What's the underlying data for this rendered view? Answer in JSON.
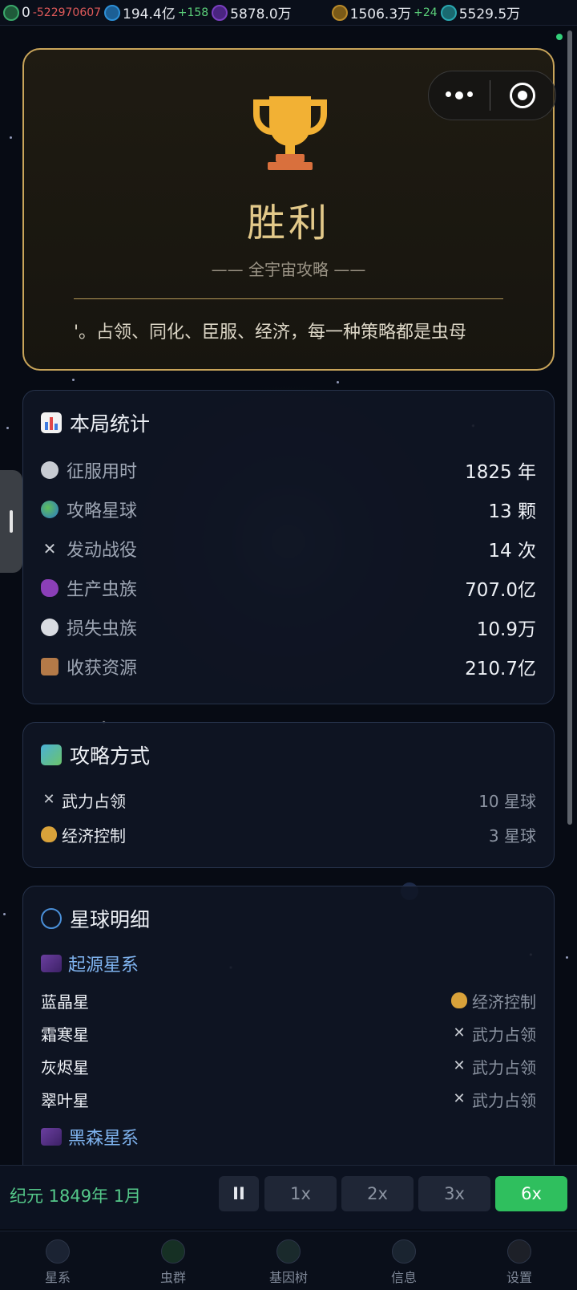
{
  "resources": [
    {
      "icon": "dna-icon",
      "color": "#3aa86a",
      "value": "0",
      "delta": "-522970607",
      "delta_type": "neg"
    },
    {
      "icon": "gem-icon",
      "color": "#2d8fd6",
      "value": "194.4亿",
      "delta": "+158",
      "delta_type": "pos"
    },
    {
      "icon": "orb-icon",
      "color": "#7a3fc0",
      "value": "5878.0万",
      "delta": "",
      "delta_type": ""
    },
    {
      "icon": "coin-icon",
      "color": "#b98a2a",
      "value": "1506.3万",
      "delta": "+24",
      "delta_type": "pos"
    },
    {
      "icon": "gear-icon",
      "color": "#2aa7b0",
      "value": "5529.5万",
      "delta": "",
      "delta_type": ""
    }
  ],
  "victory": {
    "title": "胜利",
    "subtitle": "—— 全宇宙攻略 ——",
    "description": "'。占领、同化、臣服、经济，每一种策略都是虫母"
  },
  "stats": {
    "title": "本局统计",
    "rows": [
      {
        "icon": "stopwatch-icon",
        "label": "征服用时",
        "value": "1825 年"
      },
      {
        "icon": "globe-icon",
        "label": "攻略星球",
        "value": "13 颗"
      },
      {
        "icon": "crossed-swords-icon",
        "label": "发动战役",
        "value": "14 次"
      },
      {
        "icon": "worm-icon",
        "label": "生产虫族",
        "value": "707.0亿"
      },
      {
        "icon": "skull-icon",
        "label": "损失虫族",
        "value": "10.9万"
      },
      {
        "icon": "package-icon",
        "label": "收获资源",
        "value": "210.7亿"
      }
    ]
  },
  "methods": {
    "title": "攻略方式",
    "rows": [
      {
        "icon": "crossed-swords-icon",
        "label": "武力占领",
        "value": "10 星球"
      },
      {
        "icon": "money-bag-icon",
        "label": "经济控制",
        "value": "3 星球"
      }
    ]
  },
  "planets": {
    "title": "星球明细",
    "groups": [
      {
        "name": "起源星系",
        "items": [
          {
            "name": "蓝晶星",
            "method": "经济控制",
            "method_icon": "money-bag-icon"
          },
          {
            "name": "霜寒星",
            "method": "武力占领",
            "method_icon": "crossed-swords-icon"
          },
          {
            "name": "灰烬星",
            "method": "武力占领",
            "method_icon": "crossed-swords-icon"
          },
          {
            "name": "翠叶星",
            "method": "武力占领",
            "method_icon": "crossed-swords-icon"
          }
        ]
      },
      {
        "name": "黑森星系",
        "items": []
      }
    ]
  },
  "speedbar": {
    "era": "纪元 1849年 1月",
    "pause_label": "II",
    "speeds": [
      "1x",
      "2x",
      "3x",
      "6x"
    ],
    "active_speed": "6x"
  },
  "nav": [
    {
      "icon": "planet-icon",
      "label": "星系"
    },
    {
      "icon": "bug-icon",
      "label": "虫群"
    },
    {
      "icon": "dna-tree-icon",
      "label": "基因树"
    },
    {
      "icon": "info-icon",
      "label": "信息"
    },
    {
      "icon": "settings-icon",
      "label": "设置"
    }
  ],
  "colors": {
    "gold": "#c9a55a",
    "accent_green": "#2fbf5e",
    "group_blue": "#7fb3ef"
  }
}
